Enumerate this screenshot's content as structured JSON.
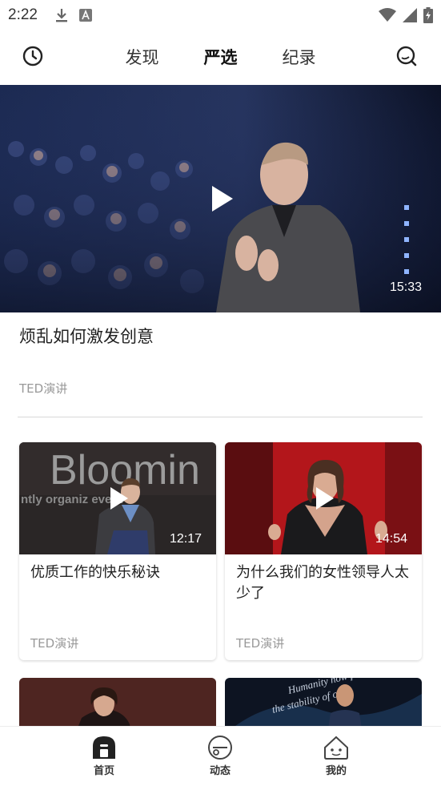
{
  "status_bar": {
    "time": "2:22"
  },
  "top_nav": {
    "tabs": [
      {
        "label": "发现"
      },
      {
        "label": "严选"
      },
      {
        "label": "纪录"
      }
    ],
    "active_tab": "严选"
  },
  "hero": {
    "duration": "15:33",
    "title": "烦乱如何激发创意",
    "source": "TED演讲"
  },
  "cards": [
    {
      "duration": "12:17",
      "title": "优质工作的快乐秘诀",
      "source": "TED演讲",
      "thumb_text": "Bloomin",
      "thumb_subtext": "ntly organiz        event"
    },
    {
      "duration": "14:54",
      "title": "为什么我们的女性领导人太少了",
      "source": "TED演讲"
    }
  ],
  "bottom_nav": {
    "items": [
      {
        "label": "首页",
        "icon": "home-icon"
      },
      {
        "label": "动态",
        "icon": "feed-icon"
      },
      {
        "label": "我的",
        "icon": "profile-icon"
      }
    ]
  },
  "colors": {
    "accent": "#111111",
    "hero_bg": "#1a2440",
    "card2_bg": "#b3161b"
  }
}
